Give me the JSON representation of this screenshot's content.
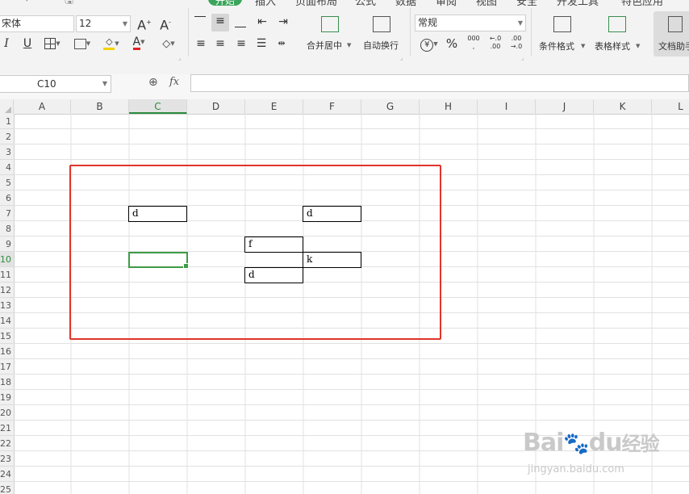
{
  "menu": {
    "items": [
      {
        "label": "开始",
        "active": true
      },
      {
        "label": "插入"
      },
      {
        "label": "页面布局"
      },
      {
        "label": "公式"
      },
      {
        "label": "数据"
      },
      {
        "label": "审阅"
      },
      {
        "label": "视图"
      },
      {
        "label": "安全"
      },
      {
        "label": "开发工具"
      },
      {
        "label": "特色应用"
      }
    ]
  },
  "ribbon": {
    "font_name": "宋体",
    "font_size": "12",
    "number_format": "常规",
    "merge_center_label": "合并居中",
    "wrap_text_label": "自动换行",
    "conditional_format_label": "条件格式",
    "table_style_label": "表格样式",
    "doc_assistant_label": "文档助手",
    "percent_label": "%",
    "thousands_label": "000",
    "dec_increase_label": ".00",
    "dec_decrease_label": ".0",
    "font_increase": "A",
    "font_decrease": "A",
    "italic": "I",
    "underline": "U",
    "font_color_letter": "A",
    "currency_symbol": "¥",
    "accent_color": "#3aa55a"
  },
  "formula_bar": {
    "name_box": "C10",
    "fx_label": "fx",
    "value": ""
  },
  "sheet": {
    "columns": [
      "A",
      "B",
      "C",
      "D",
      "E",
      "F",
      "G",
      "H",
      "I",
      "J",
      "K",
      "L"
    ],
    "active_column": "C",
    "rows": [
      "1",
      "2",
      "3",
      "4",
      "5",
      "6",
      "7",
      "8",
      "9",
      "10",
      "11",
      "12",
      "13",
      "14",
      "15",
      "16",
      "17",
      "18",
      "19",
      "20",
      "21",
      "22",
      "23",
      "24",
      "25"
    ],
    "active_row": "10",
    "cells": [
      {
        "ref": "C7",
        "value": "d"
      },
      {
        "ref": "F7",
        "value": "d"
      },
      {
        "ref": "E9",
        "value": "f"
      },
      {
        "ref": "F10",
        "value": "k"
      },
      {
        "ref": "E11",
        "value": "d"
      }
    ],
    "active_cell": "C10",
    "highlight_color": "#e0352a",
    "selection_color": "#3f9b46"
  },
  "watermark": {
    "brand": "Bai",
    "brand_suffix": "du",
    "cn_text": "经验",
    "url": "jingyan.baidu.com"
  }
}
